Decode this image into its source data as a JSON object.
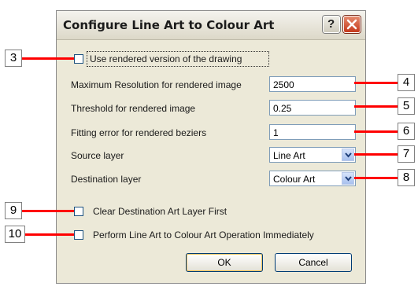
{
  "dialog": {
    "title": "Configure Line Art to Colour Art",
    "help_glyph": "?"
  },
  "options": {
    "use_rendered": {
      "label": "Use rendered version of the drawing",
      "checked": false
    },
    "max_resolution": {
      "label": "Maximum Resolution for rendered image",
      "value": "2500"
    },
    "threshold": {
      "label": "Threshold for rendered image",
      "value": "0.25"
    },
    "fitting_error": {
      "label": "Fitting error for rendered beziers",
      "value": "1"
    },
    "source_layer": {
      "label": "Source layer",
      "value": "Line Art"
    },
    "destination_layer": {
      "label": "Destination layer",
      "value": "Colour Art"
    },
    "clear_destination": {
      "label": "Clear Destination Art Layer First",
      "checked": false
    },
    "perform_immediately": {
      "label": "Perform Line Art to Colour Art Operation Immediately",
      "checked": false
    }
  },
  "buttons": {
    "ok": "OK",
    "cancel": "Cancel"
  },
  "callouts": [
    "3",
    "4",
    "5",
    "6",
    "7",
    "8",
    "9",
    "10"
  ],
  "colors": {
    "callout_line": "#ff0000",
    "close_button": "#c5391c",
    "dialog_bg": "#ece9d8"
  }
}
